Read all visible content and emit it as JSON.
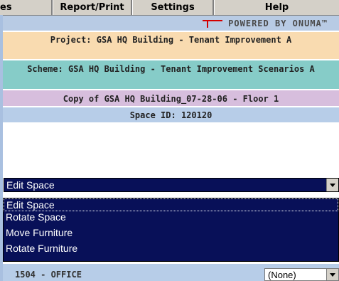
{
  "tabs": [
    {
      "label": "es"
    },
    {
      "label": "Report/Print"
    },
    {
      "label": "Settings"
    },
    {
      "label": "Help"
    }
  ],
  "powered_by": {
    "text": "POWERED BY ONUMA™",
    "logo_icon": "onuma-logo-icon",
    "logo_color": "#d40000"
  },
  "info": {
    "project": "Project: GSA HQ Building - Tenant Improvement A",
    "scheme": "Scheme: GSA HQ Building - Tenant Improvement Scenarios A",
    "copy": "Copy of GSA HQ Building_07-28-06 - Floor 1",
    "space_id": "Space ID: 120120"
  },
  "action_select": {
    "value": "Edit Space",
    "options": [
      "Edit Space",
      "Rotate Space",
      "Move Furniture",
      "Rotate Furniture"
    ],
    "selected_index": 0
  },
  "space_row": {
    "name": "1504 - OFFICE",
    "filter_value": "(None)"
  },
  "colors": {
    "project_band": "#f9dbb0",
    "scheme_band": "#86ccc8",
    "copy_band": "#d7bedd",
    "space_id_band": "#b7cde8",
    "select_bg": "#081058"
  }
}
